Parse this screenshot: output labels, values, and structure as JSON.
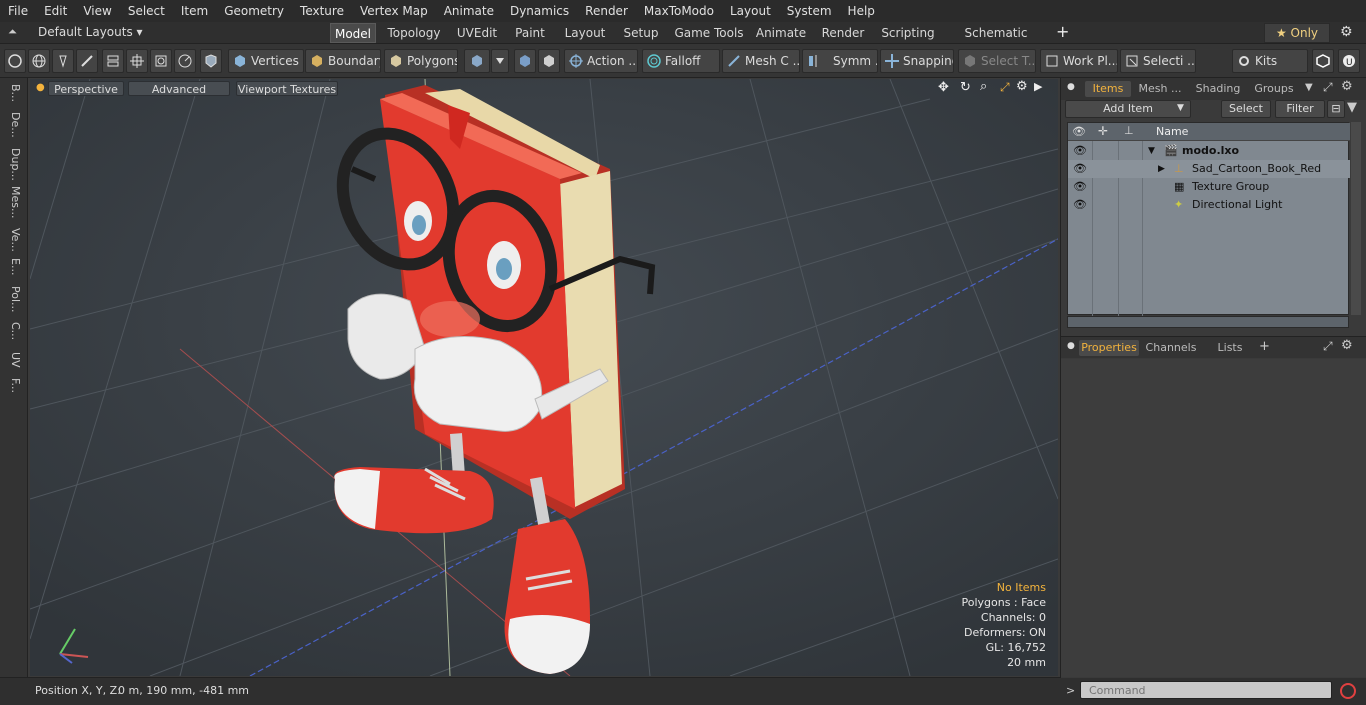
{
  "menu": [
    "File",
    "Edit",
    "View",
    "Select",
    "Item",
    "Geometry",
    "Texture",
    "Vertex Map",
    "Animate",
    "Dynamics",
    "Render",
    "MaxToModo",
    "Layout",
    "System",
    "Help"
  ],
  "layouts": {
    "default_label": "Default Layouts ▾",
    "tabs": [
      "Model",
      "Topology",
      "UVEdit",
      "Paint",
      "Layout",
      "Setup",
      "Game Tools",
      "Animate",
      "Render",
      "Scripting",
      "Schematic Fusion"
    ],
    "add": "+",
    "only_label": "★ Only"
  },
  "toolbar": {
    "vertices": "Vertices",
    "boundary": "Boundary",
    "polygons": "Polygons",
    "action": "Action ...",
    "falloff": "Falloff",
    "mesh": "Mesh C ...",
    "symm": "Symm ...",
    "snapping": "Snapping",
    "select_t": "Select T...",
    "workpl": "Work Pl...",
    "selecti": "Selecti ...",
    "kits": "Kits"
  },
  "left_tabs": [
    "B...",
    "De...",
    "Dup...",
    "Mes...",
    "Ve...",
    "E...",
    "Pol...",
    "C...",
    "UV",
    "F..."
  ],
  "viewport": {
    "perspective": "Perspective",
    "advanced": "Advanced",
    "textures": "Viewport Textures",
    "stats": {
      "no_items": "No Items",
      "polygons": "Polygons : Face",
      "channels": "Channels: 0",
      "deformers": "Deformers: ON",
      "gl": "GL: 16,752",
      "scale": "20 mm"
    }
  },
  "status": {
    "position_label": "Position X, Y, Z:",
    "position_value": "0 m, 190 mm, -481 mm"
  },
  "items_panel": {
    "tabs": [
      "Items",
      "Mesh ...",
      "Shading",
      "Groups"
    ],
    "add_item": "Add Item",
    "select": "Select",
    "filter": "Filter",
    "col_name": "Name",
    "rows": [
      "modo.lxo",
      "Sad_Cartoon_Book_Red",
      "Texture Group",
      "Directional Light"
    ]
  },
  "props_panel": {
    "tabs": [
      "Properties",
      "Channels",
      "Lists"
    ],
    "add": "+"
  },
  "command": {
    "placeholder": "Command",
    "prompt": ">"
  },
  "colors": {
    "accent": "#f3b33d",
    "book_red": "#e23a2e",
    "viewport_bg": "#3b4147"
  }
}
